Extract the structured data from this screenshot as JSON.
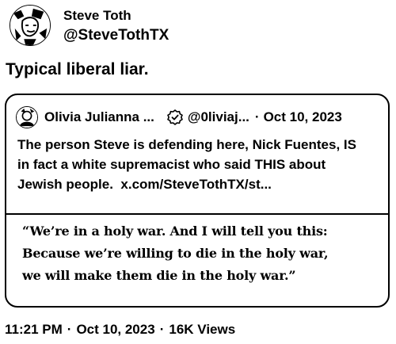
{
  "author": {
    "display_name": "Steve Toth",
    "handle": "@SteveTothTX",
    "avatar_icon": "author-avatar-illustration"
  },
  "tweet": {
    "text": "Typical liberal liar."
  },
  "quote": {
    "display_name": "Olivia Julianna ...",
    "verified_icon": "verified-badge-icon",
    "handle": "@0liviaj...",
    "separator": "·",
    "date": "Oct 10, 2023",
    "text_lines": [
      "The person Steve is defending here, Nick Fuentes, IS",
      "in fact a white supremacist who said THIS about",
      "Jewish people."
    ],
    "link": "x.com/SteveTothTX/st...",
    "media_quote_lines": [
      "“We’re in a holy war. And I will tell you this:",
      "Because we’re willing to die in the holy war,",
      "we will make them die in the holy war.”"
    ]
  },
  "footer": {
    "time": "11:21 PM",
    "date": "Oct 10, 2023",
    "views_count": "16K",
    "views_label": "Views",
    "separator": "·"
  }
}
